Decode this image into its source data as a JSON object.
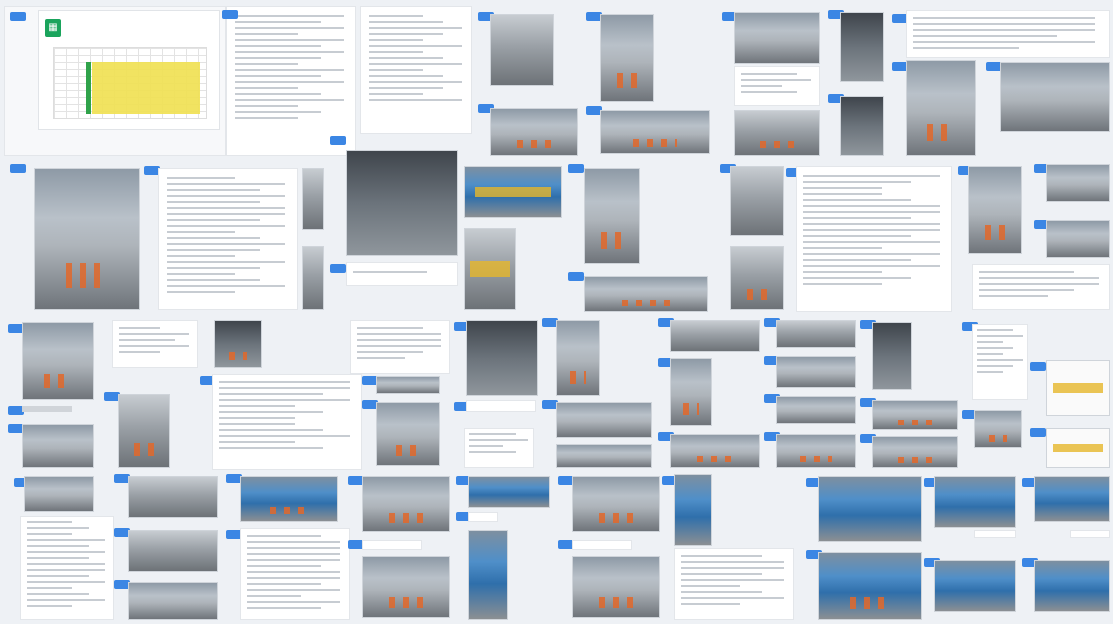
{
  "chat_log": {
    "shared_file": {
      "icon": "spreadsheet-icon",
      "name": "",
      "subtitle": "",
      "actions": [
        "",
        "",
        ""
      ]
    }
  },
  "colors": {
    "background": "#eef1f5",
    "avatar_blue": "#3b86e4",
    "file_green": "#1aa45c",
    "highlight_yellow": "#f0e050"
  }
}
